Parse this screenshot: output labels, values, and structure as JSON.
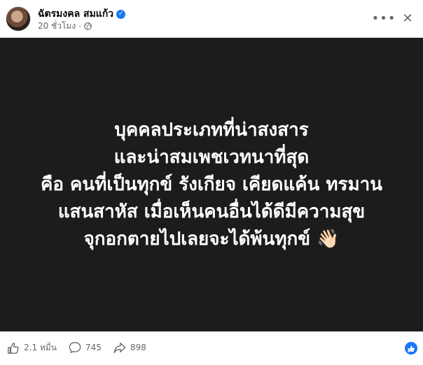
{
  "post": {
    "author": "ฉัตรมงคล สมแก้ว",
    "time": "20 ชั่วโมง",
    "text_lines": [
      "บุคคลประเภทที่น่าสงสาร",
      "และน่าสมเพชเวทนาที่สุด",
      "คือ คนที่เป็นทุกข์ รังเกียจ เคียดแค้น ทรมาน",
      "แสนสาหัส เมื่อเห็นคนอื่นได้ดีมีความสุข",
      "จุกอกตายไปเลยจะได้พ้นทุกข์ 👋🏻"
    ]
  },
  "stats": {
    "likes": "2.1 หมื่น",
    "comments": "745",
    "shares": "898"
  },
  "icons": {
    "more": "more-icon",
    "close": "close-icon",
    "verified": "verified-icon",
    "privacy": "globe-icon",
    "like": "like-icon",
    "comment": "comment-icon",
    "share": "share-icon"
  },
  "colors": {
    "accent": "#1877f2",
    "image_bg": "#1c1c1c",
    "secondary_text": "#65676b"
  }
}
